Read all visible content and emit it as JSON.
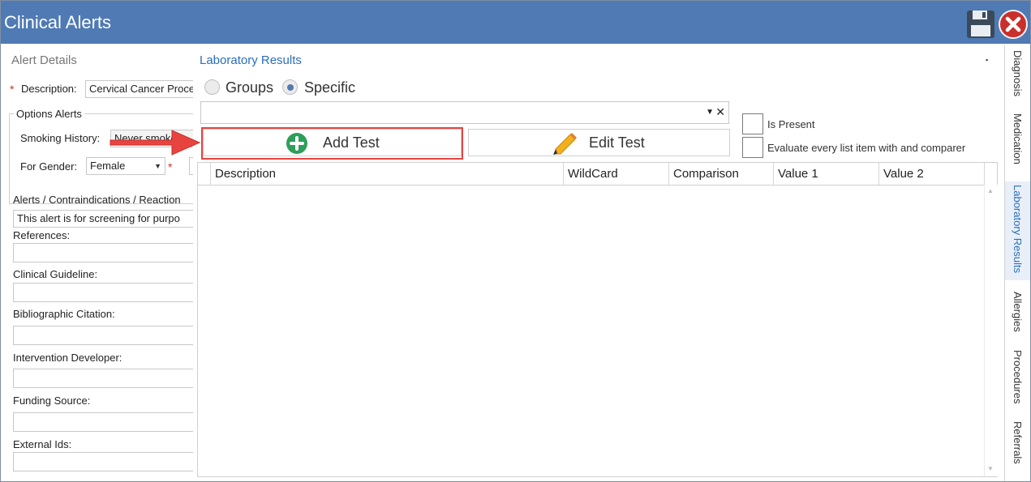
{
  "window": {
    "title": "Clinical Alerts",
    "accent": "#4f7ab4"
  },
  "left": {
    "section_title": "Alert Details",
    "description_label": "Description:",
    "description_value": "Cervical Cancer Proce",
    "options_group": "Options Alerts",
    "smoking_label": "Smoking History:",
    "smoking_value": "Never smoke",
    "gender_label": "For Gender:",
    "gender_value": "Female",
    "required_mark": "*",
    "alerts_label": "Alerts / Contraindications / Reaction",
    "alerts_value": "This alert is for screening for purpo",
    "references_label": "References:",
    "guideline_label": "Clinical Guideline:",
    "citation_label": "Bibliographic Citation:",
    "developer_label": "Intervention Developer:",
    "funding_label": "Funding Source:",
    "external_label": "External Ids:"
  },
  "main": {
    "title": "Laboratory Results",
    "radio_groups": "Groups",
    "radio_specific": "Specific",
    "selected_radio": "Specific",
    "add_test": "Add Test",
    "edit_test": "Edit Test",
    "is_present": "Is Present",
    "evaluate_every": "Evaluate every list item with and comparer",
    "columns": [
      "Description",
      "WildCard",
      "Comparison",
      "Value 1",
      "Value 2"
    ],
    "rows": []
  },
  "tabs": [
    "Diagnosis",
    "Medication",
    "Laboratory Results",
    "Allergies",
    "Procedures",
    "Referrals"
  ],
  "active_tab": "Laboratory Results",
  "icons": {
    "save": "floppy-disk-icon",
    "close": "close-icon",
    "add": "plus-circle-icon",
    "edit": "pencil-icon",
    "pin": "pin-icon"
  },
  "colors": {
    "highlight": "#e8443f",
    "add_icon": "#2e9e5b",
    "link_blue": "#2a6ebb"
  }
}
